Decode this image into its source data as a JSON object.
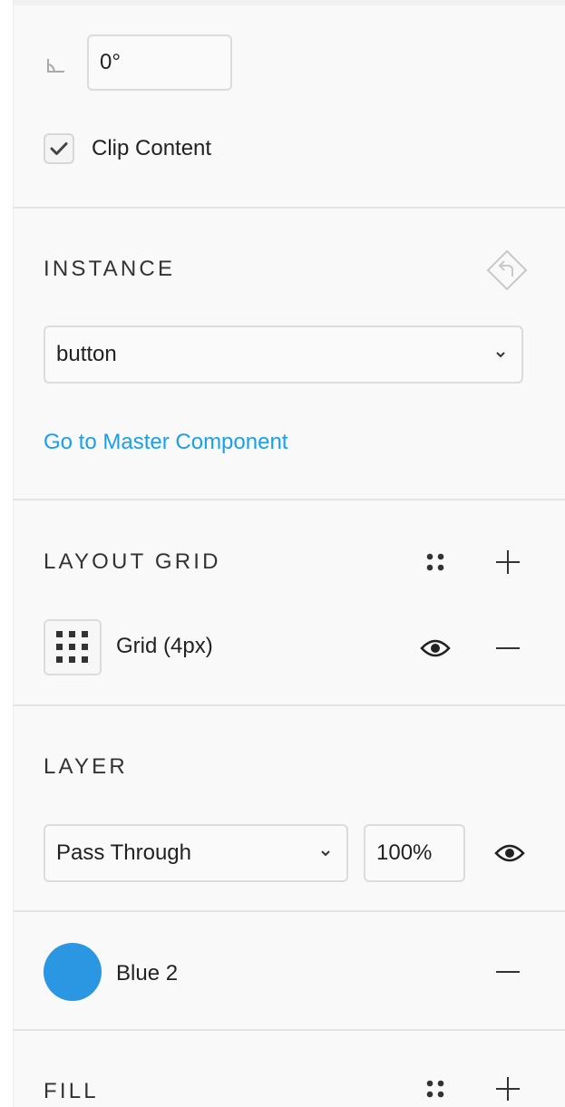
{
  "rotation": {
    "value": "0°"
  },
  "clip_content": {
    "label": "Clip Content",
    "checked": true
  },
  "instance": {
    "title": "INSTANCE",
    "component_select": {
      "value": "button"
    },
    "master_link": "Go to Master Component"
  },
  "layout_grid": {
    "title": "LAYOUT GRID",
    "items": [
      {
        "label": "Grid (4px)"
      }
    ]
  },
  "layer": {
    "title": "LAYER",
    "blend_mode": "Pass Through",
    "opacity": "100%"
  },
  "style": {
    "name": "Blue 2",
    "color": "#2b97e2"
  },
  "fill": {
    "title": "FILL"
  },
  "colors": {
    "accent": "#18a0f0",
    "border": "#dcdcdc",
    "divider": "#e3e3e3"
  }
}
